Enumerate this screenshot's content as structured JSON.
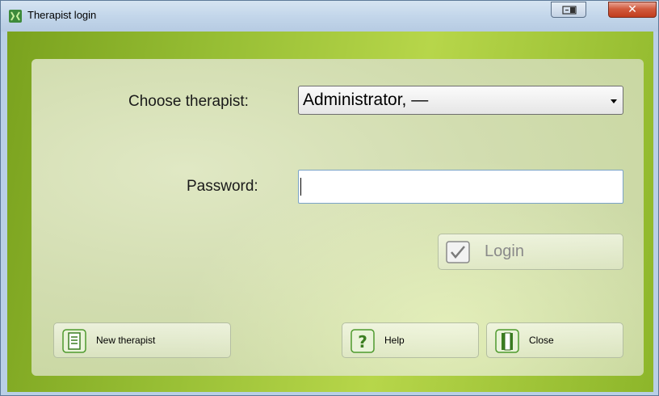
{
  "window": {
    "title": "Therapist login"
  },
  "form": {
    "therapist_label": "Choose therapist:",
    "therapist_selected": "Administrator, —",
    "password_label": "Password:",
    "password_value": ""
  },
  "buttons": {
    "login": "Login",
    "new_therapist": "New therapist",
    "help": "Help",
    "close": "Close"
  },
  "colors": {
    "accent_green": "#8db62a",
    "titlebar": "#c3d6ea",
    "close_red": "#c13c1d"
  }
}
